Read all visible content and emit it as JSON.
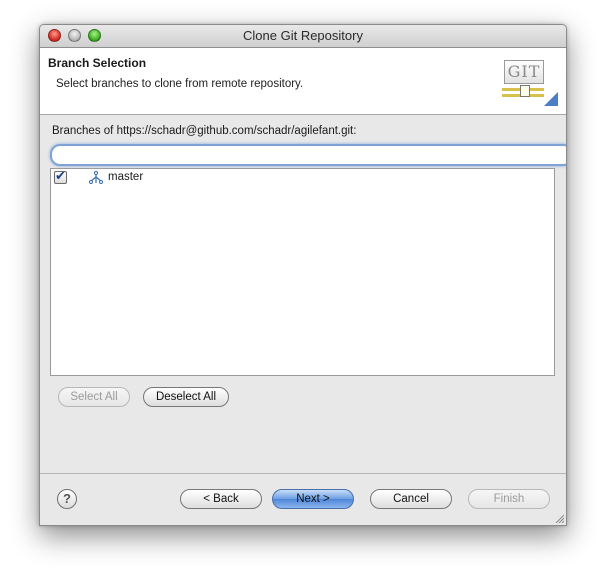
{
  "window": {
    "title": "Clone Git Repository"
  },
  "header": {
    "title": "Branch Selection",
    "description": "Select branches to clone from remote repository.",
    "logo_text": "GIT"
  },
  "branches": {
    "label": "Branches of https://schadr@github.com/schadr/agilefant.git:",
    "filter_value": "",
    "items": [
      {
        "name": "master",
        "checked": true,
        "icon": "branch-icon"
      }
    ]
  },
  "selection_buttons": {
    "select_all": "Select All",
    "deselect_all": "Deselect All"
  },
  "footer": {
    "help": "?",
    "back": "< Back",
    "next": "Next >",
    "cancel": "Cancel",
    "finish": "Finish"
  },
  "colors": {
    "default_button": "#5b92df",
    "focus_ring": "#7ea3d8"
  }
}
